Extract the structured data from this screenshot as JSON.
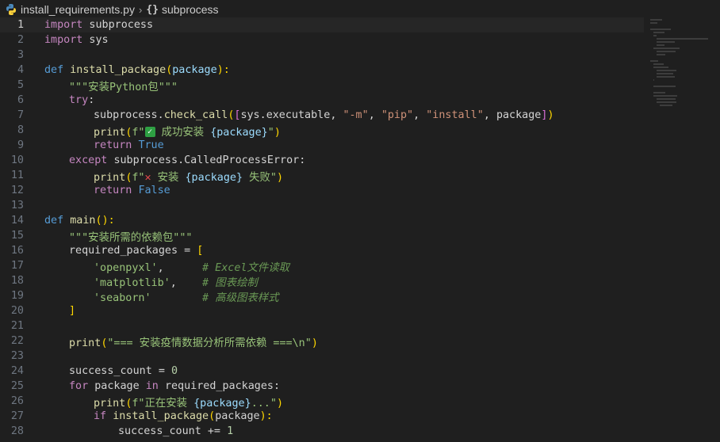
{
  "breadcrumb": {
    "file": "install_requirements.py",
    "separator": "›",
    "symbol_icon": "{}",
    "symbol": "subprocess"
  },
  "editor": {
    "current_line": 1,
    "lines": [
      {
        "n": "1"
      },
      {
        "n": "2"
      },
      {
        "n": "3"
      },
      {
        "n": "4"
      },
      {
        "n": "5"
      },
      {
        "n": "6"
      },
      {
        "n": "7"
      },
      {
        "n": "8"
      },
      {
        "n": "9"
      },
      {
        "n": "10"
      },
      {
        "n": "11"
      },
      {
        "n": "12"
      },
      {
        "n": "13"
      },
      {
        "n": "14"
      },
      {
        "n": "15"
      },
      {
        "n": "16"
      },
      {
        "n": "17"
      },
      {
        "n": "18"
      },
      {
        "n": "19"
      },
      {
        "n": "20"
      },
      {
        "n": "21"
      },
      {
        "n": "22"
      },
      {
        "n": "23"
      },
      {
        "n": "24"
      },
      {
        "n": "25"
      },
      {
        "n": "26"
      },
      {
        "n": "27"
      },
      {
        "n": "28"
      }
    ],
    "code": {
      "l1": [
        "import",
        " subprocess"
      ],
      "l2": [
        "import",
        " sys"
      ],
      "l4": [
        "def",
        " ",
        "install_package",
        "(",
        "package",
        "):"
      ],
      "l5": [
        "\"\"\"安装Python包\"\"\""
      ],
      "l6": [
        "try",
        ":"
      ],
      "l7": [
        "subprocess",
        ".",
        "check_call",
        "(",
        "[",
        "sys",
        ".",
        "executable",
        ", ",
        "\"-m\"",
        ", ",
        "\"pip\"",
        ", ",
        "\"install\"",
        ", ",
        "package",
        "]",
        ")"
      ],
      "l8": [
        "print",
        "(",
        "f\"",
        "✓",
        " 成功安装 ",
        "{package}",
        "\"",
        ")"
      ],
      "l9": [
        "return",
        " ",
        "True"
      ],
      "l10": [
        "except",
        " ",
        "subprocess",
        ".",
        "CalledProcessError",
        ":"
      ],
      "l11": [
        "print",
        "(",
        "f\"",
        "✕",
        " 安装 ",
        "{package}",
        " 失败\"",
        ")"
      ],
      "l12": [
        "return",
        " ",
        "False"
      ],
      "l14": [
        "def",
        " ",
        "main",
        "(",
        "):"
      ],
      "l15": [
        "\"\"\"安装所需的依赖包\"\"\""
      ],
      "l16": [
        "required_packages",
        " = ",
        "["
      ],
      "l17": [
        "'openpyxl'",
        ",",
        "      # Excel文件读取"
      ],
      "l18": [
        "'matplotlib'",
        ",",
        "    # 图表绘制"
      ],
      "l19": [
        "'seaborn'",
        "        # 高级图表样式"
      ],
      "l20": [
        "]"
      ],
      "l22": [
        "print",
        "(",
        "\"=== 安装疫情数据分析所需依赖 ===\\n\"",
        ")"
      ],
      "l24": [
        "success_count",
        " = ",
        "0"
      ],
      "l25": [
        "for",
        " ",
        "package",
        " ",
        "in",
        " ",
        "required_packages",
        ":"
      ],
      "l26": [
        "print",
        "(",
        "f\"正在安装 ",
        "{package}",
        "...\"",
        ")"
      ],
      "l27": [
        "if",
        " ",
        "install_package",
        "(",
        "package",
        "):"
      ],
      "l28": [
        "success_count",
        " += ",
        "1"
      ]
    }
  },
  "colors": {
    "background": "#1f1f1f",
    "keyword": "#c586c0",
    "storage": "#569cd6",
    "function": "#dcdcaa",
    "string": "#ce9178",
    "variable": "#9cdcfe",
    "comment": "#6a9955"
  },
  "icons": {
    "file": "python-file-icon",
    "symbol": "braces-icon"
  }
}
